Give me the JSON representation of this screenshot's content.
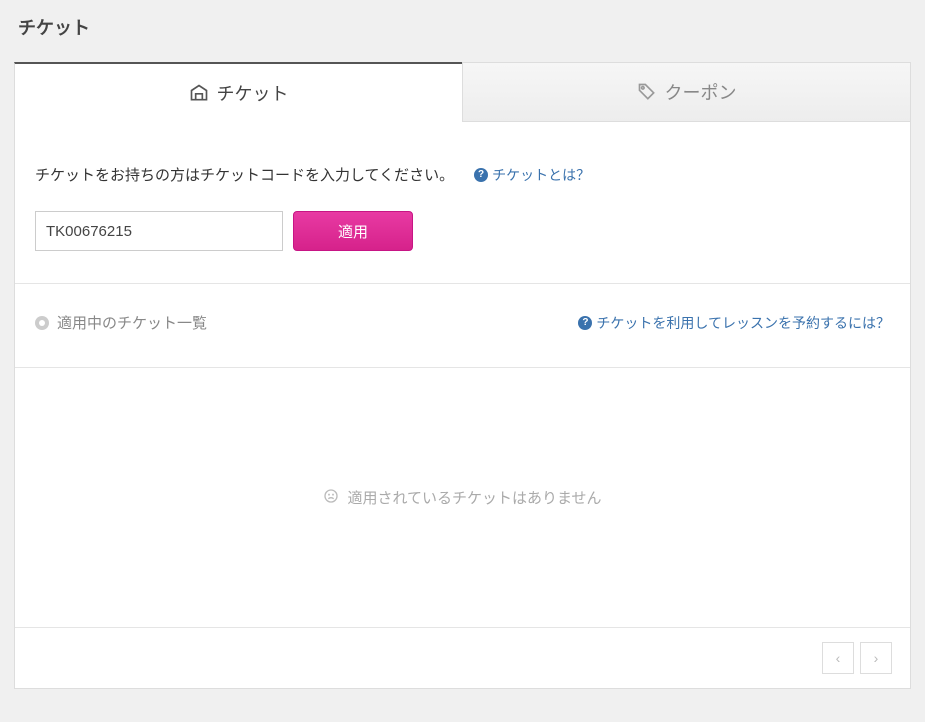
{
  "page": {
    "title": "チケット"
  },
  "tabs": {
    "ticket": {
      "label": "チケット"
    },
    "coupon": {
      "label": "クーポン"
    }
  },
  "entry": {
    "instruction": "チケットをお持ちの方はチケットコードを入力してください。",
    "help_label": "チケットとは？",
    "input_value": "TK00676215",
    "apply_label": "適用"
  },
  "list": {
    "heading": "適用中のチケット一覧",
    "help_label": "チケットを利用してレッスンを予約するには？"
  },
  "empty": {
    "message": "適用されているチケットはありません"
  }
}
